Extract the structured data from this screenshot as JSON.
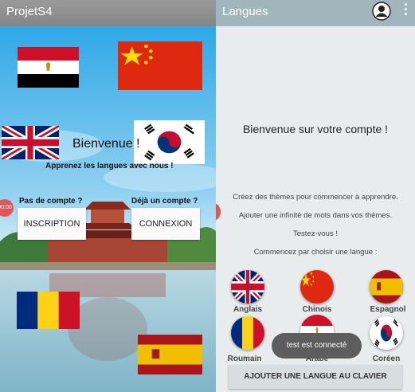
{
  "left_screen": {
    "app_title": "ProjetS4",
    "welcome": "Bienvenue !",
    "tagline": "Apprenez les langues avec nous !",
    "no_account_label": "Pas de compte ?",
    "has_account_label": "Déjà un compte ?",
    "signup_button": "INSCRIPTION",
    "login_button": "CONNEXION",
    "record_dot": "00:00"
  },
  "right_screen": {
    "title": "Langues",
    "welcome": "Bienvenue sur votre compte !",
    "lines": [
      "Créez des thèmes pour commencer à apprendre.",
      "Ajouter une infinité de mots dans vos thèmes.",
      "Testez-vous !",
      "Commencez par choisir une langue :"
    ],
    "languages": [
      {
        "label": "Anglais",
        "icon": "uk-flag-icon"
      },
      {
        "label": "Chinois",
        "icon": "china-flag-icon"
      },
      {
        "label": "Espagnol",
        "icon": "spain-flag-icon"
      },
      {
        "label": "Roumain",
        "icon": "romania-flag-icon"
      },
      {
        "label": "Arabe",
        "icon": "egypt-flag-icon"
      },
      {
        "label": "Coréen",
        "icon": "korea-flag-icon"
      }
    ],
    "toast": "test est connecté",
    "add_language_button": "AJOUTER UNE LANGUE AU CLAVIER"
  }
}
